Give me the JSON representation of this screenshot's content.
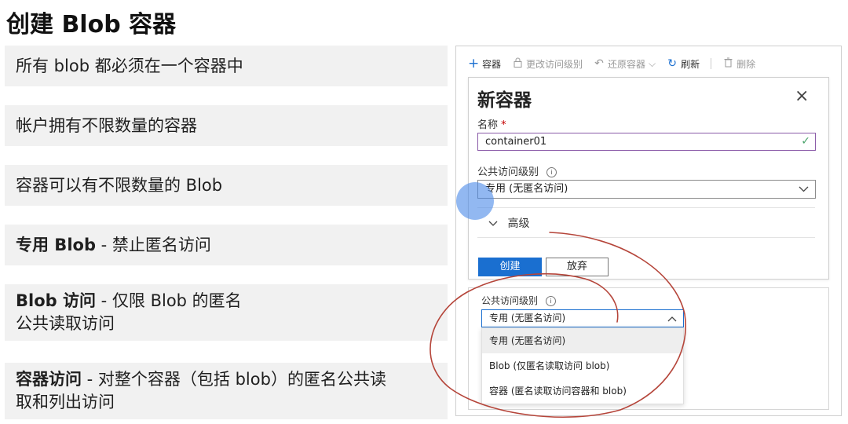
{
  "slide": {
    "title": "创建 Blob 容器",
    "bullets": [
      {
        "bold": "",
        "text": "所有 blob 都必须在一个容器中"
      },
      {
        "bold": "",
        "text": "帐户拥有不限数量的容器"
      },
      {
        "bold": "",
        "text": "容器可以有不限数量的 Blob"
      },
      {
        "bold": "专用 Blob",
        "text": " - 禁止匿名访问"
      },
      {
        "bold": "Blob 访问",
        "text": " - 仅限 Blob 的匿名",
        "line2": "公共读取访问"
      },
      {
        "bold": "容器访问",
        "text": " - 对整个容器（包括 blob）的匿名公共读",
        "line2": "取和列出访问"
      }
    ]
  },
  "toolbar": {
    "add": "容器",
    "change_access": "更改访问级别",
    "restore": "还原容器",
    "refresh": "刷新",
    "delete": "删除"
  },
  "dialog": {
    "title": "新容器",
    "close": "×",
    "name_label": "名称",
    "required_mark": "*",
    "name_value": "container01",
    "access_label": "公共访问级别",
    "access_value": "专用 (无匿名访问)",
    "advanced": "高级",
    "create": "创建",
    "discard": "放弃"
  },
  "dropdown_panel": {
    "label": "公共访问级别",
    "selected": "专用 (无匿名访问)",
    "options": [
      "专用 (无匿名访问)",
      "Blob (仅匿名读取访问 blob)",
      "容器 (匿名读取访问容器和 blob)"
    ]
  },
  "colors": {
    "accent": "#1a6fd0",
    "annotation": "#b5453a",
    "cursor": "#4a89e8"
  }
}
